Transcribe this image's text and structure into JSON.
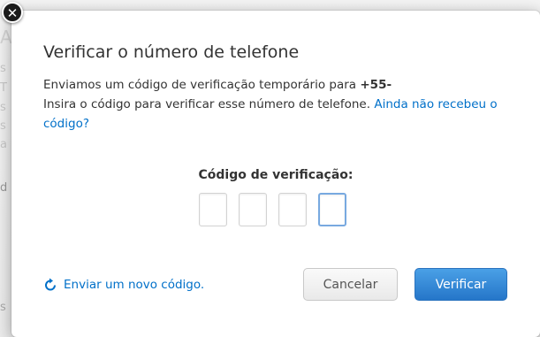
{
  "dialog": {
    "title": "Verificar o número de telefone",
    "line1_prefix": "Enviamos um código de verificação temporário para ",
    "phone": "+55-",
    "line2": "Insira o código para verificar esse número de telefone. ",
    "not_received_link": "Ainda não recebeu o código?",
    "code_label": "Código de verificação:",
    "code_digits": [
      "",
      "",
      "",
      ""
    ],
    "resend_label": "Enviar um novo código.",
    "cancel_label": "Cancelar",
    "verify_label": "Verificar",
    "close_symbol": "✕"
  },
  "icons": {
    "close": "close-icon",
    "resend": "refresh-icon"
  },
  "colors": {
    "link": "#0070c9",
    "primary_button": "#2f80d1"
  }
}
